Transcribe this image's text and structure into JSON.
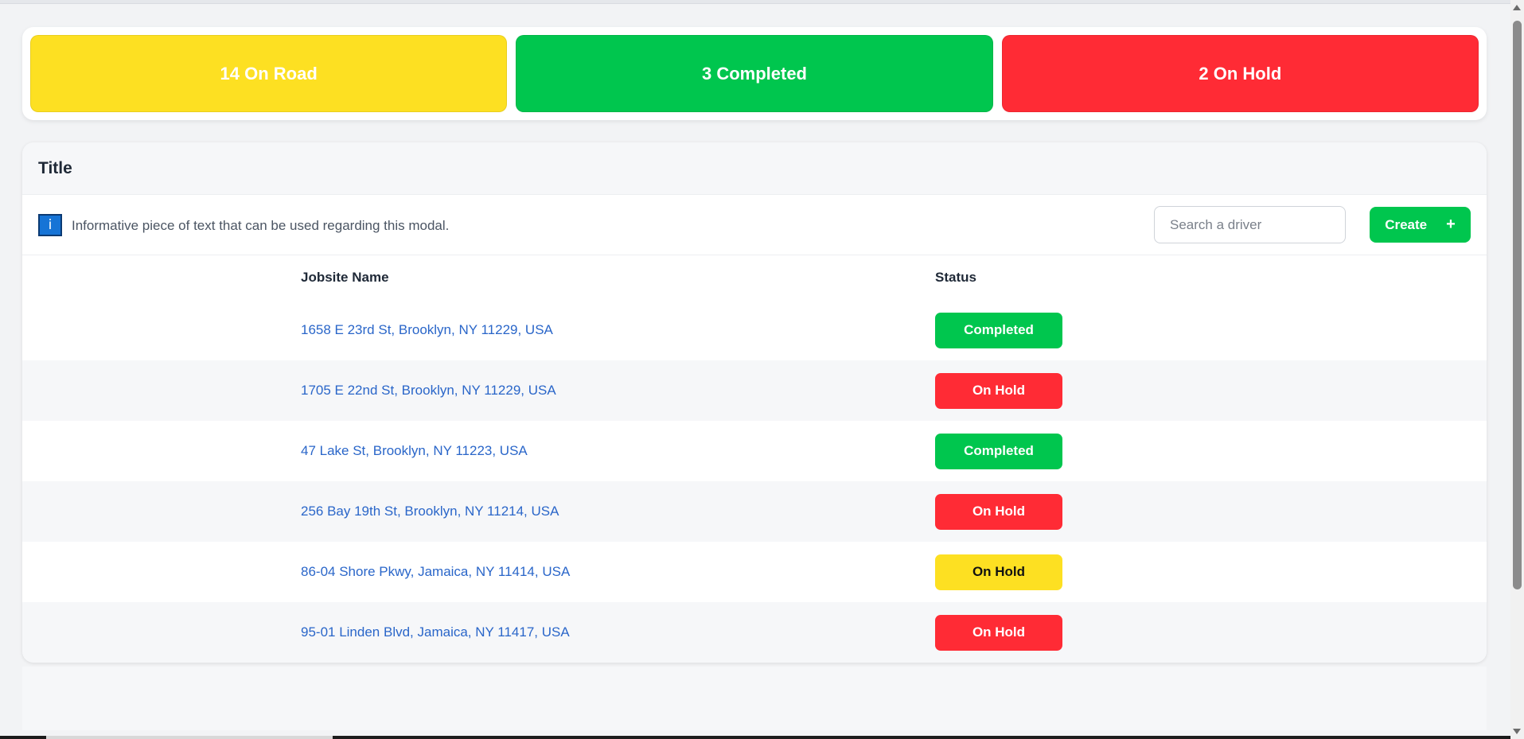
{
  "summary": {
    "on_road": "14 On Road",
    "completed": "3 Completed",
    "on_hold": "2 On Hold"
  },
  "panel": {
    "title": "Title",
    "info_text": "Informative piece of text that can be used regarding this modal.",
    "info_icon": "i",
    "search_placeholder": "Search a driver",
    "create_label": "Create",
    "create_icon": "+"
  },
  "table": {
    "headers": [
      "Jobsite Name",
      "Status"
    ],
    "rows": [
      {
        "jobsite": "1658 E 23rd St, Brooklyn, NY 11229, USA",
        "status": "Completed",
        "status_color": "#00c64e"
      },
      {
        "jobsite": "1705 E 22nd St, Brooklyn, NY 11229, USA",
        "status": "On Hold",
        "status_color": "#ff2b35"
      },
      {
        "jobsite": "47 Lake St, Brooklyn, NY 11223, USA",
        "status": "Completed",
        "status_color": "#00c64e"
      },
      {
        "jobsite": "256 Bay 19th St, Brooklyn, NY 11214, USA",
        "status": "On Hold",
        "status_color": "#ff2b35"
      },
      {
        "jobsite": "86-04 Shore Pkwy, Jamaica, NY 11414, USA",
        "status": "On Hold",
        "status_color": "#fde022"
      },
      {
        "jobsite": "95-01 Linden Blvd, Jamaica, NY 11417, USA",
        "status": "On Hold",
        "status_color": "#ff2b35"
      }
    ]
  },
  "colors": {
    "yellow": "#fde022",
    "green": "#00c64e",
    "red": "#ff2b35",
    "link": "#2a66c9"
  }
}
